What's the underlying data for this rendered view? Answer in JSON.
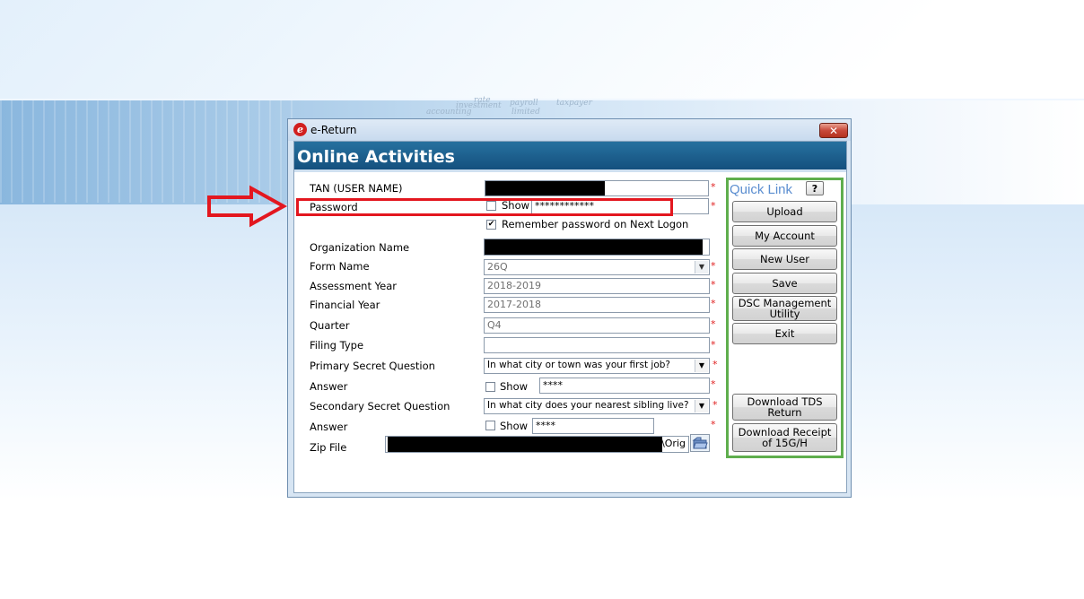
{
  "background": {
    "words": [
      "accounting",
      "investment",
      "rate",
      "payroll",
      "limited",
      "taxpayer"
    ]
  },
  "window": {
    "title": "e-Return",
    "icon": "e-return-app-icon",
    "close_label": "✕",
    "header": "Online Activities"
  },
  "form": {
    "tan_label": "TAN (USER NAME)",
    "password_label": "Password",
    "password_show_label": "Show",
    "password_value": "************",
    "remember_label": "Remember password on Next Logon",
    "remember_checked": true,
    "org_label": "Organization Name",
    "form_name_label": "Form Name",
    "form_name_value": "26Q",
    "assessment_year_label": "Assessment Year",
    "assessment_year_value": "2018-2019",
    "financial_year_label": "Financial Year",
    "financial_year_value": "2017-2018",
    "quarter_label": "Quarter",
    "quarter_value": "Q4",
    "filing_type_label": "Filing Type",
    "filing_type_value": "",
    "primary_q_label": "Primary Secret Question",
    "primary_q_value": "In what city or town was your first job?",
    "answer1_label": "Answer",
    "answer1_show_label": "Show",
    "answer1_value": "****",
    "secondary_q_label": "Secondary Secret Question",
    "secondary_q_value": "In what city does your nearest sibling live?",
    "answer2_label": "Answer",
    "answer2_show_label": "Show",
    "answer2_value": "****",
    "zip_label": "Zip File",
    "zip_value_tail": "\\Orig",
    "required_mark": "*"
  },
  "quick_link": {
    "title": "Quick Link",
    "help_label": "?",
    "buttons": [
      "Upload",
      "My Account",
      "New User",
      "Save",
      "DSC Management Utility",
      "Exit",
      "Download TDS Return",
      "Download Receipt of 15G/H"
    ]
  },
  "colors": {
    "header_bg": "#1d5f8e",
    "quick_link_border": "#5fae4d",
    "highlight_red": "#e3171f",
    "required_red": "#e02020"
  }
}
